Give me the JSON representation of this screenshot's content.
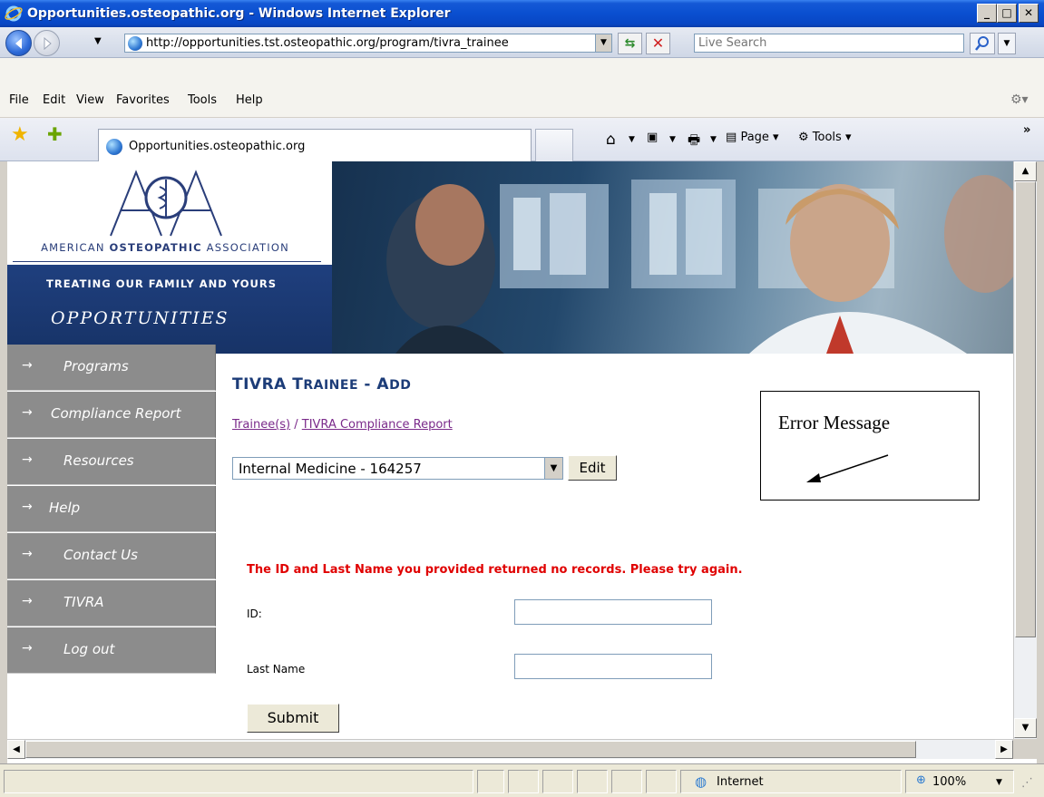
{
  "window": {
    "title": "Opportunities.osteopathic.org - Windows Internet Explorer",
    "controls": {
      "minimize": "_",
      "maximize": "□",
      "close": "✕"
    }
  },
  "address_bar": {
    "url": "http://opportunities.tst.osteopathic.org/program/tivra_trainee",
    "search_placeholder": "Live Search"
  },
  "menu": {
    "items": [
      "File",
      "Edit",
      "View",
      "Favorites",
      "Tools",
      "Help"
    ]
  },
  "tabs": {
    "active_label": "Opportunities.osteopathic.org"
  },
  "command_bar": {
    "page_label": "Page",
    "tools_label": "Tools"
  },
  "site": {
    "association_bold": "OSTEOPATHIC",
    "association_pre": "AMERICAN ",
    "association_post": " ASSOCIATION",
    "tagline": "TREATING OUR FAMILY AND YOURS",
    "brand": "OPPORTUNITIES",
    "logo_letters": "AOA"
  },
  "sidebar": {
    "items": [
      {
        "label": "Programs"
      },
      {
        "label": "Compliance Report"
      },
      {
        "label": "Resources"
      },
      {
        "label": "Help"
      },
      {
        "label": "Contact Us"
      },
      {
        "label": "TIVRA"
      },
      {
        "label": "Log out"
      }
    ],
    "arrow": "→"
  },
  "main": {
    "title_part1": "TIVRA T",
    "title_part2": "RAINEE",
    "title_sep": " - ",
    "title_part3": "A",
    "title_part4": "DD",
    "breadcrumb": {
      "link1": "Trainee(s)",
      "sep": " / ",
      "link2": "TIVRA Compliance Report"
    },
    "program_select_value": "Internal Medicine - 164257",
    "edit_label": "Edit",
    "error_message": "The ID and Last Name you provided returned no records. Please try again.",
    "id_label": "ID:",
    "last_name_label": "Last Name",
    "submit_label": "Submit",
    "id_value": "",
    "last_name_value": ""
  },
  "callout": {
    "text": "Error Message"
  },
  "status_bar": {
    "zone": "Internet",
    "zoom": "100%"
  },
  "colors": {
    "error": "#e00000",
    "title": "#1c3c78",
    "sidebar": "#8c8c8c",
    "brand_band": "#1f3f7e",
    "titlebar": "#0a4fd0"
  }
}
